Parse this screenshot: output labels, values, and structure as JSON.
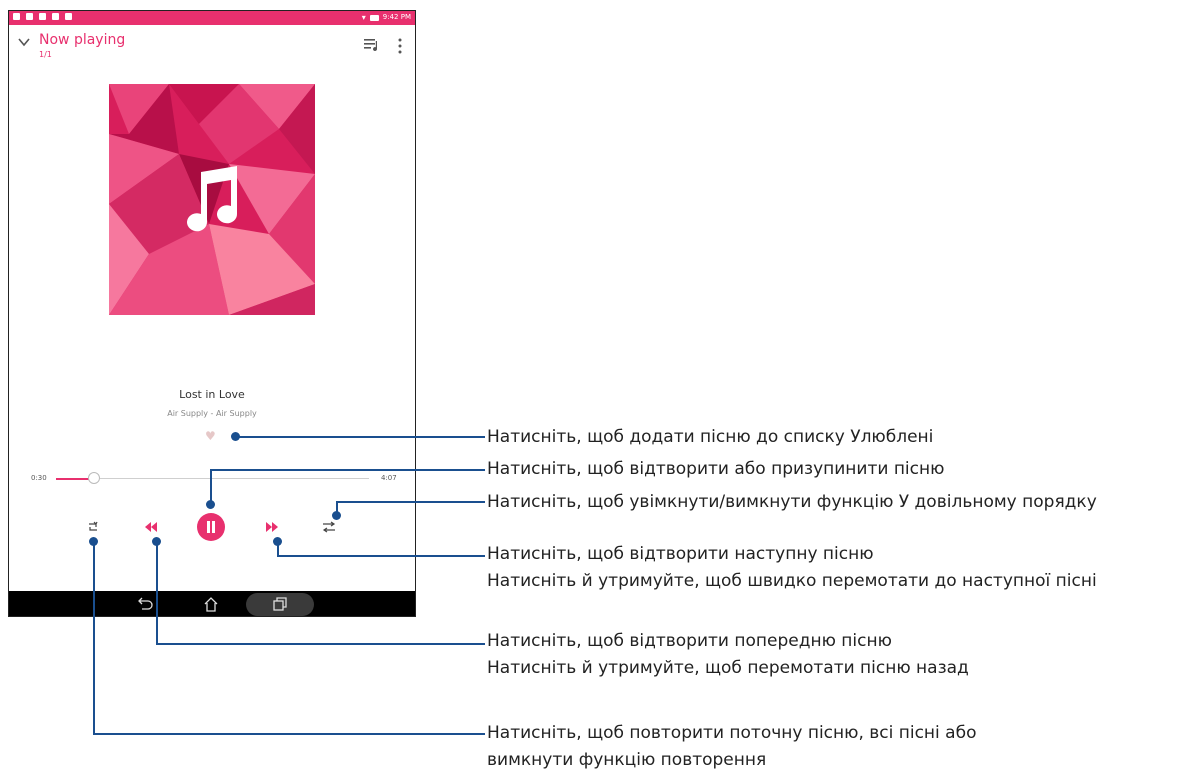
{
  "status_bar": {
    "time": "9:42 PM"
  },
  "header": {
    "title": "Now playing",
    "count": "1/1"
  },
  "song": {
    "title": "Lost in Love",
    "artist": "Air Supply - Air Supply"
  },
  "progress": {
    "current": "0:30",
    "total": "4:07",
    "fraction": 0.12
  },
  "colors": {
    "accent": "#e8306e",
    "callout": "#1a4f8f",
    "art_base": "#d81e5b"
  },
  "icons": [
    "chevron-down-icon",
    "queue-icon",
    "more-vert-icon",
    "music-note-icon",
    "heart-icon",
    "repeat-icon",
    "rewind-icon",
    "pause-icon",
    "fast-forward-icon",
    "shuffle-icon",
    "back-icon",
    "home-icon",
    "recents-icon"
  ],
  "callouts": {
    "favorite": [
      "Натисніть, щоб додати пісню до списку Улюблені"
    ],
    "play_pause": [
      "Натисніть, щоб відтворити або призупинити пісню"
    ],
    "shuffle": [
      "Натисніть, щоб увімкнути/вимкнути функцію У довільному порядку"
    ],
    "next": [
      "Натисніть, щоб відтворити наступну пісню",
      "Натисніть й утримуйте, щоб швидко перемотати до наступної пісні"
    ],
    "previous": [
      "Натисніть, щоб відтворити попередню пісню",
      "Натисніть й утримуйте, щоб перемотати пісню назад"
    ],
    "repeat": [
      "Натисніть, щоб повторити поточну пісню, всі пісні або",
      "вимкнути функцію повторення"
    ]
  }
}
